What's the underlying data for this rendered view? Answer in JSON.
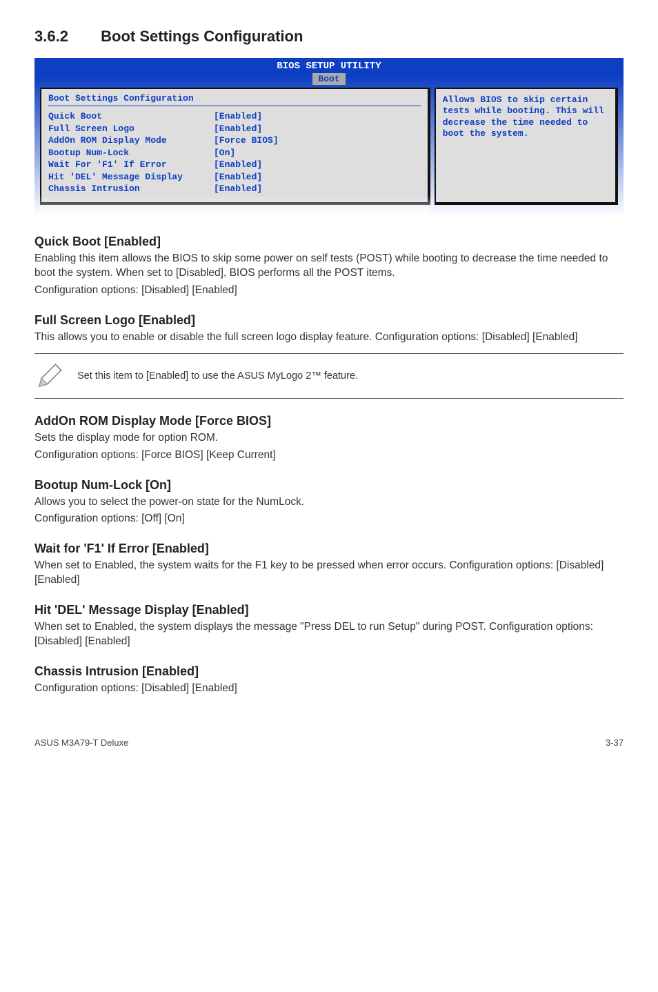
{
  "section": {
    "number": "3.6.2",
    "title": "Boot Settings Configuration"
  },
  "bios": {
    "header": "BIOS SETUP UTILITY",
    "tab": "Boot",
    "left_title": "Boot Settings Configuration",
    "rows": [
      {
        "label": "Quick Boot",
        "value": "[Enabled]"
      },
      {
        "label": "Full Screen Logo",
        "value": "[Enabled]"
      },
      {
        "label": "AddOn ROM Display Mode",
        "value": "[Force BIOS]"
      },
      {
        "label": "Bootup Num-Lock",
        "value": "[On]"
      },
      {
        "label": "Wait For 'F1' If Error",
        "value": "[Enabled]"
      },
      {
        "label": "Hit 'DEL' Message Display",
        "value": "[Enabled]"
      },
      {
        "label": "Chassis Intrusion",
        "value": "[Enabled]"
      }
    ],
    "help": "Allows BIOS to skip certain tests while booting. This will decrease the time needed to boot the system."
  },
  "subs": {
    "quick_boot": {
      "h": "Quick Boot [Enabled]",
      "p1": "Enabling this item allows the BIOS to skip some power on self tests (POST) while booting to decrease the time needed to boot the system. When set to [Disabled], BIOS performs all the POST items.",
      "p2": "Configuration options: [Disabled] [Enabled]"
    },
    "full_screen": {
      "h": "Full Screen Logo [Enabled]",
      "p1": "This allows you to enable or disable the full screen logo display feature. Configuration options: [Disabled] [Enabled]"
    },
    "note": "Set this item to [Enabled] to use the ASUS MyLogo 2™ feature.",
    "addon": {
      "h": "AddOn ROM Display Mode [Force BIOS]",
      "p1": "Sets the display mode for option ROM.",
      "p2": "Configuration options: [Force BIOS] [Keep Current]"
    },
    "numlock": {
      "h": "Bootup Num-Lock [On]",
      "p1": "Allows you to select the power-on state for the NumLock.",
      "p2": "Configuration options: [Off] [On]"
    },
    "waitf1": {
      "h": "Wait for 'F1' If Error [Enabled]",
      "p1": "When set to Enabled, the system waits for the F1 key to be pressed when error occurs. Configuration options: [Disabled] [Enabled]"
    },
    "hitdel": {
      "h": "Hit 'DEL' Message Display [Enabled]",
      "p1": "When set to Enabled, the system displays the message \"Press DEL to run Setup\" during POST. Configuration options: [Disabled] [Enabled]"
    },
    "chassis": {
      "h": "Chassis Intrusion [Enabled]",
      "p1": "Configuration options: [Disabled] [Enabled]"
    }
  },
  "footer": {
    "left": "ASUS M3A79-T Deluxe",
    "right": "3-37"
  }
}
